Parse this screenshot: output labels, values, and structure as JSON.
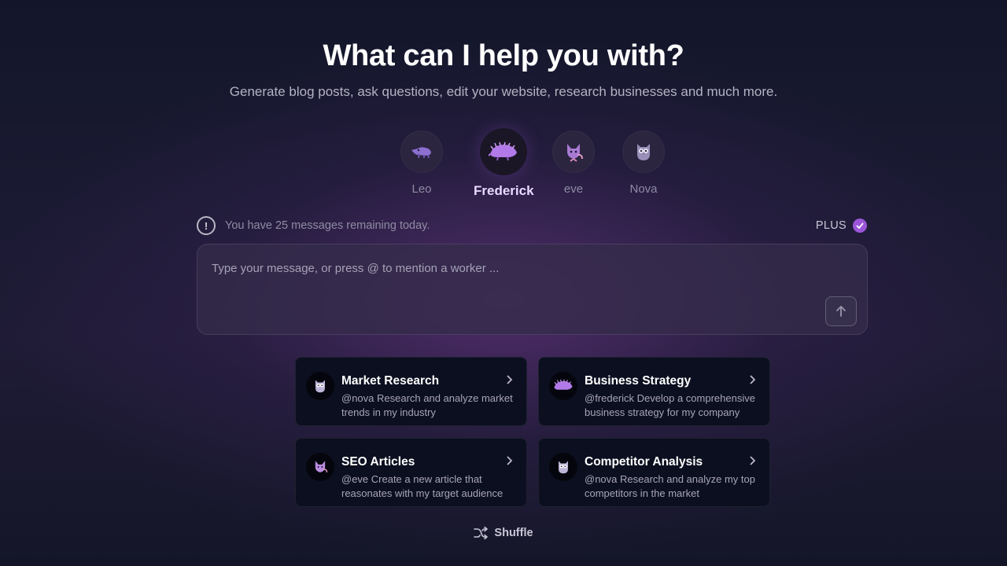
{
  "headline": "What can I help you with?",
  "subline": "Generate blog posts, ask questions, edit your website, research businesses and much more.",
  "workers": [
    {
      "name": "Leo",
      "icon": "anteater-icon",
      "active": false
    },
    {
      "name": "Frederick",
      "icon": "hedgehog-icon",
      "active": true
    },
    {
      "name": "eve",
      "icon": "fox-icon",
      "active": false
    },
    {
      "name": "Nova",
      "icon": "owl-icon",
      "active": false
    }
  ],
  "notice": {
    "text": "You have 25 messages remaining today.",
    "plan_label": "PLUS"
  },
  "composer": {
    "placeholder": "Type your message, or press @ to mention a worker ..."
  },
  "cards": [
    {
      "title": "Market Research",
      "desc": "@nova Research and analyze market trends in my industry",
      "icon": "owl-icon"
    },
    {
      "title": "Business Strategy",
      "desc": "@frederick Develop a comprehensive business strategy for my company",
      "icon": "hedgehog-icon"
    },
    {
      "title": "SEO Articles",
      "desc": "@eve Create a new article that reasonates with my target audience",
      "icon": "fox-icon"
    },
    {
      "title": "Competitor Analysis",
      "desc": "@nova Research and analyze my top competitors in the market",
      "icon": "owl-icon"
    }
  ],
  "shuffle_label": "Shuffle",
  "colors": {
    "accent": "#9a55d8",
    "active_name": "#e7d9ff",
    "card_bg": "#0c0f1f"
  }
}
